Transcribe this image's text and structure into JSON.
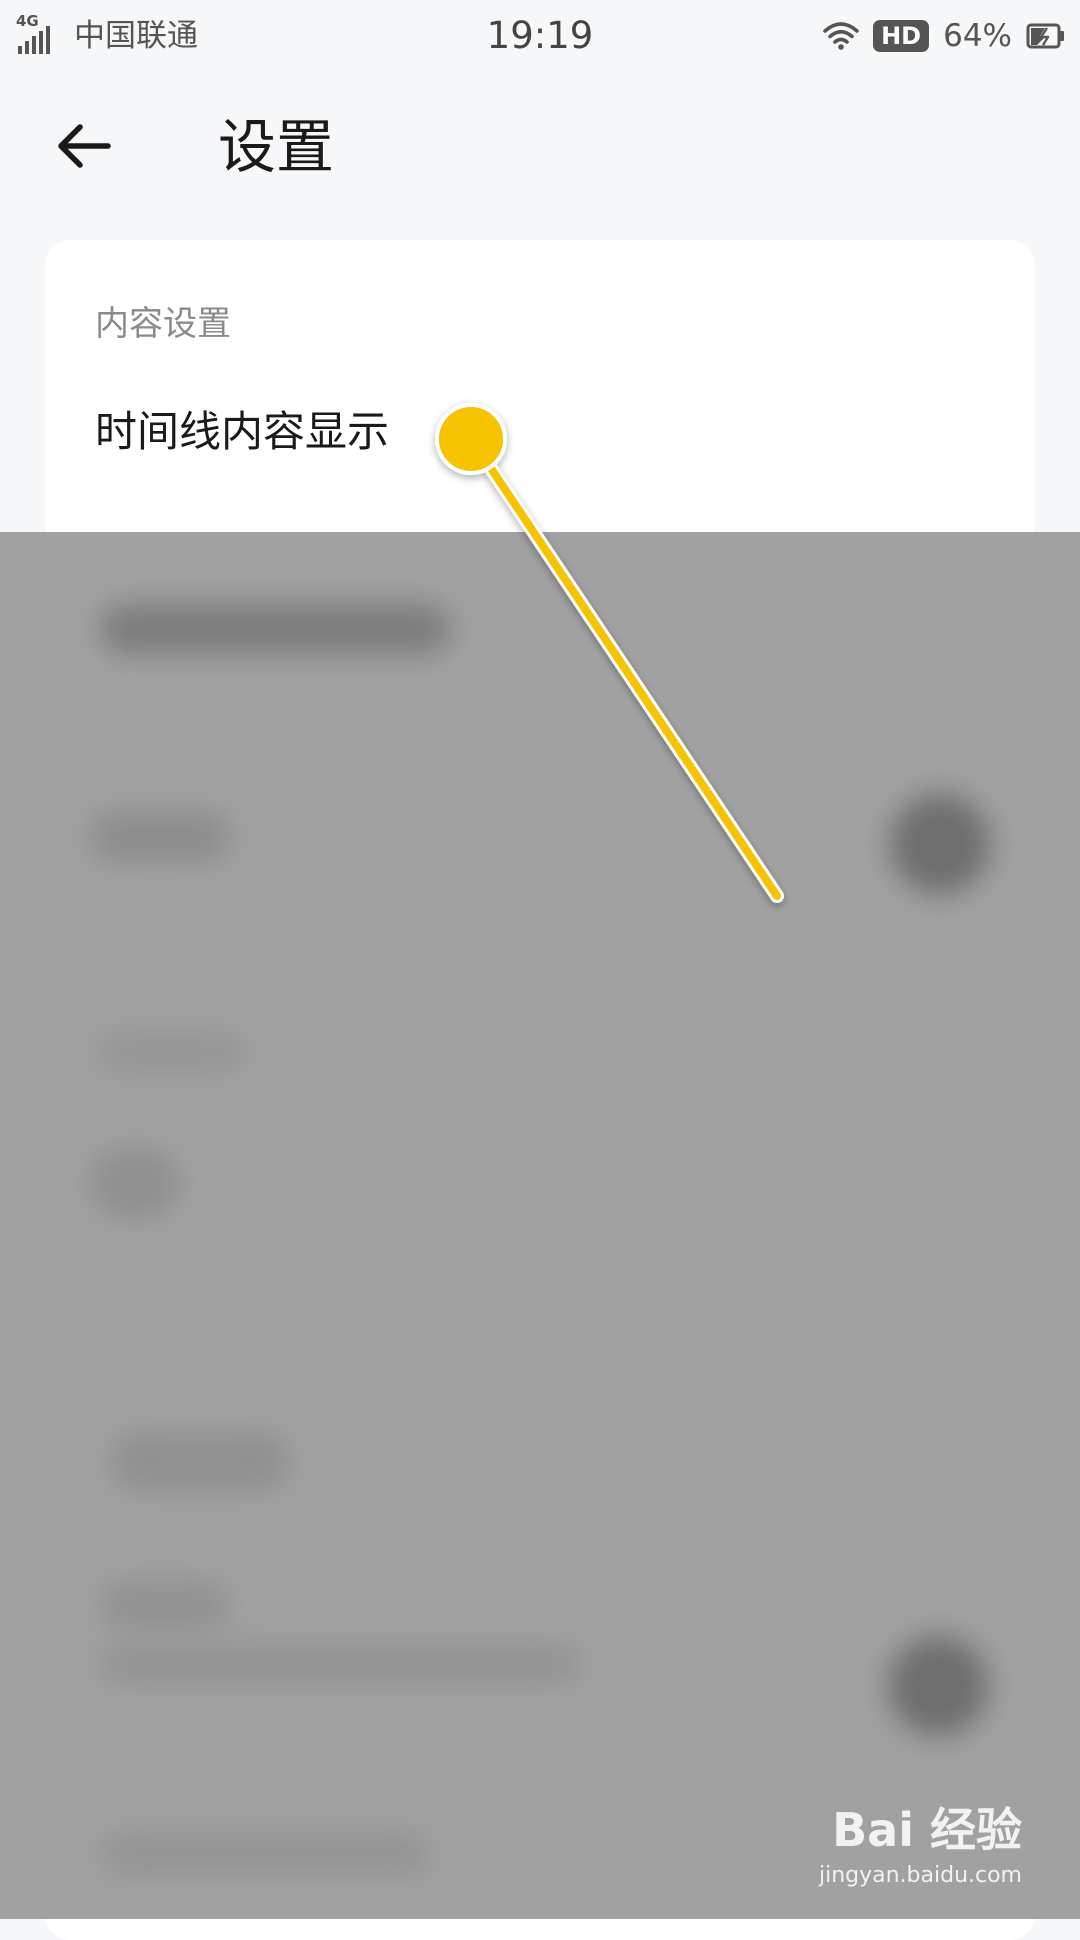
{
  "status_bar": {
    "network": "4G",
    "carrier": "中国联通",
    "time": "19:19",
    "hd_badge": "HD",
    "battery_percent": "64%",
    "icons": [
      "signal-icon",
      "wifi-icon",
      "battery-charging-icon"
    ]
  },
  "header": {
    "title": "设置",
    "back_icon": "arrow-left-icon"
  },
  "content": {
    "section_title": "内容设置",
    "items": [
      {
        "label": "时间线内容显示"
      }
    ]
  },
  "annotation": {
    "color": "#f7c200"
  },
  "watermark": {
    "brand": "Bai 经验",
    "url": "jingyan.baidu.com"
  },
  "colors": {
    "background": "#f6f7f9",
    "card": "#ffffff",
    "overlay": "#a1a1a1",
    "accent": "#f7c200"
  }
}
